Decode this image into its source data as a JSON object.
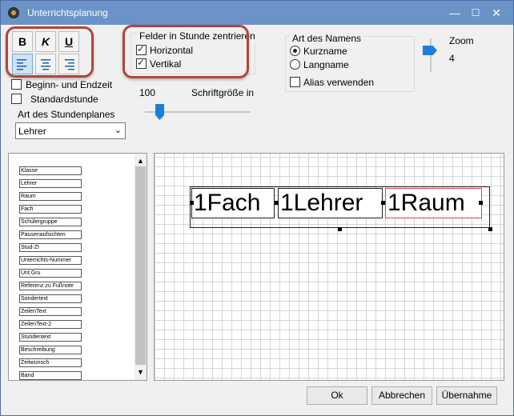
{
  "window": {
    "title": "Unterrichtsplanung"
  },
  "format": {
    "bold": "B",
    "italic": "K",
    "underline": "U"
  },
  "center_group": {
    "title": "Felder in Stunde zentrieren",
    "horizontal": "Horizontal",
    "horizontal_checked": true,
    "vertical": "Vertikal",
    "vertical_checked": true
  },
  "name_group": {
    "title": "Art des Namens",
    "kurzname": "Kurzname",
    "langname": "Langname",
    "selected": "kurzname",
    "alias": "Alias verwenden"
  },
  "zoom": {
    "label": "Zoom",
    "value": "4"
  },
  "options": {
    "begin_end": "Beginn- und Endzeit",
    "standard": "Standardstunde"
  },
  "font_size": {
    "value": "100",
    "label": "Schriftgröße in"
  },
  "plan_type": {
    "label": "Art des Stundenplanes",
    "value": "Lehrer"
  },
  "fields": [
    "Klasse",
    "Lehrer",
    "Raum",
    "Fach",
    "Schülergruppe",
    "Pausenaufsichten",
    "Stud-ZI",
    "Unterrichts-Nummer",
    "Unt.Gru",
    "Referenz zu Fußnote",
    "Sondertext",
    "ZeilenText",
    "ZeilenText-2",
    "Stundentext",
    "Beschreibung",
    "Zeitwunsch",
    "Band"
  ],
  "preview_cells": [
    "1Fach",
    "1Lehrer",
    "1Raum"
  ],
  "buttons": {
    "ok": "Ok",
    "cancel": "Abbrechen",
    "apply": "Übernahme"
  },
  "colors": {
    "titlebar": "#6b93c8",
    "highlight": "#b0463b",
    "selected_cell": "#e04848",
    "slider_accent": "#1a7fd8"
  }
}
